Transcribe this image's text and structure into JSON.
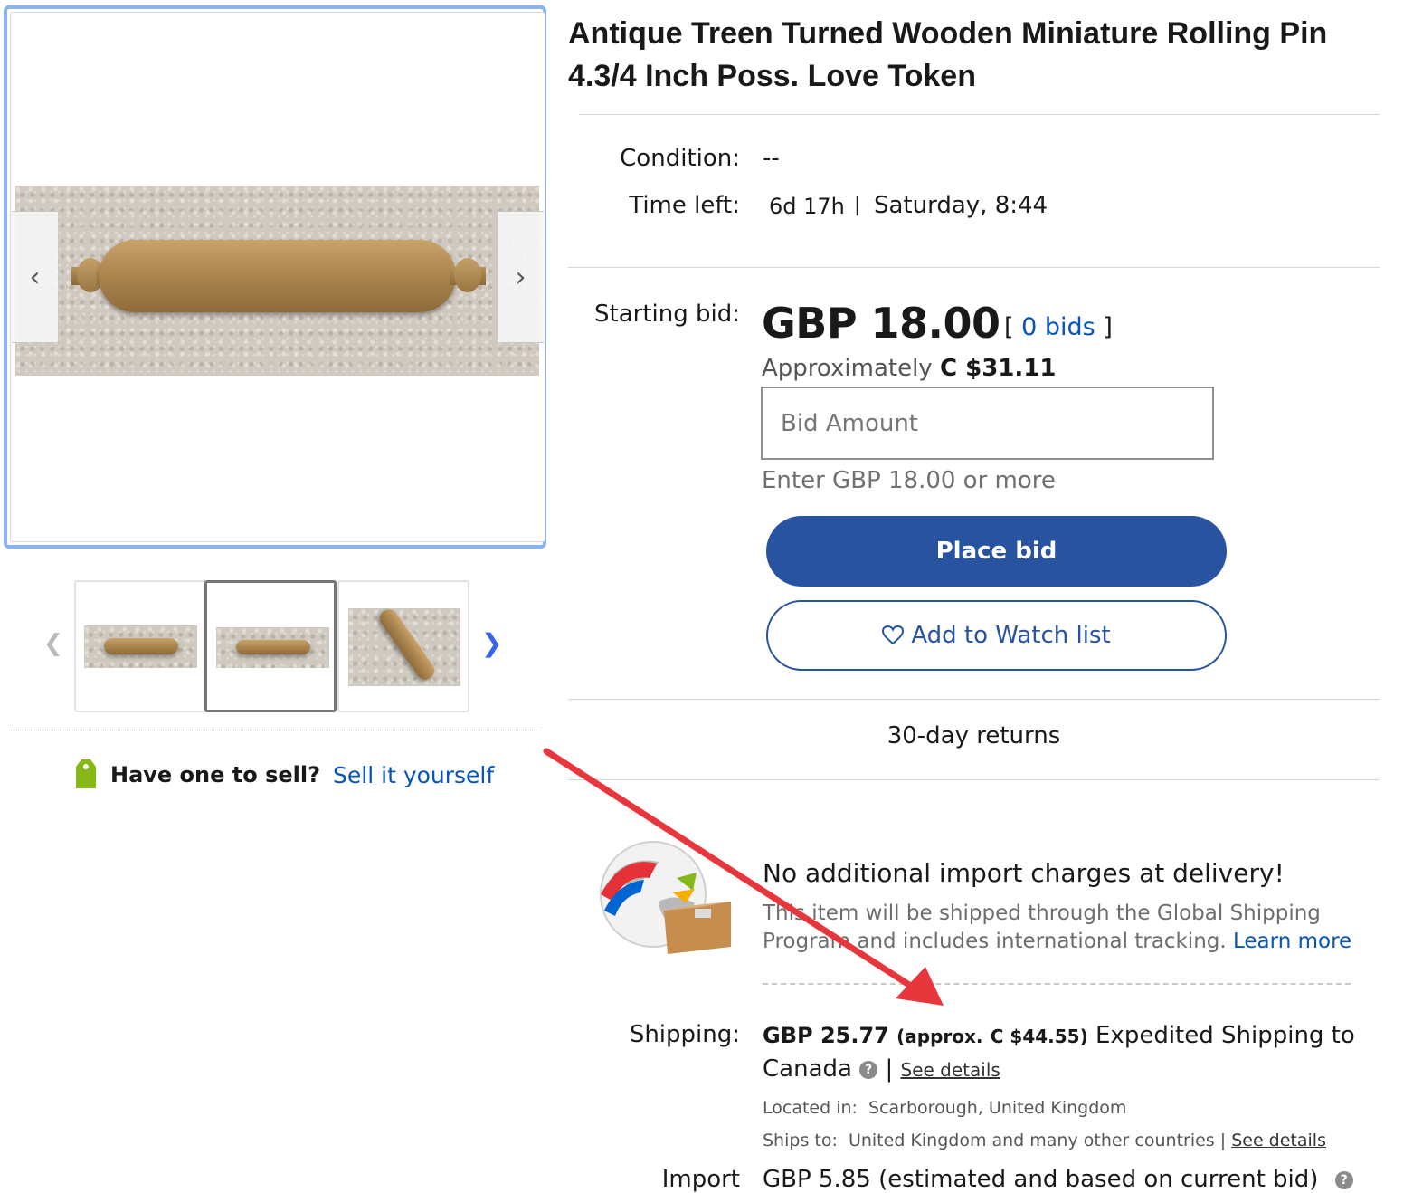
{
  "gallery": {
    "thumbnails": [
      {
        "alt": "Rolling pin full view",
        "selected": false
      },
      {
        "alt": "Rolling pin full view",
        "selected": true
      },
      {
        "alt": "Rolling pin handle close-up",
        "selected": false
      }
    ]
  },
  "sell": {
    "question": "Have one to sell?",
    "link": "Sell it yourself"
  },
  "item": {
    "title": "Antique Treen Turned Wooden Miniature Rolling Pin 4.3/4 Inch Poss. Love Token"
  },
  "details": {
    "condition_label": "Condition:",
    "condition_value": "--",
    "time_label": "Time left:",
    "time_remaining": "6d 17h",
    "time_separator": "|",
    "end_time": "Saturday, 8:44"
  },
  "bid": {
    "starting_label": "Starting bid:",
    "price": "GBP 18.00",
    "bid_open": "[",
    "bid_count": "0 bids",
    "bid_close": "]",
    "approx_prefix": "Approximately",
    "approx_value": "C $31.11",
    "input_placeholder": "Bid Amount",
    "hint": "Enter GBP 18.00 or more",
    "place_bid": "Place bid",
    "watch": "Add to Watch list"
  },
  "returns": "30-day returns",
  "gsp": {
    "heading": "No additional import charges at delivery!",
    "description": "This item will be shipped through the Global Shipping Program and includes international tracking.",
    "learn_more": "Learn more"
  },
  "shipping": {
    "label": "Shipping:",
    "amount": "GBP 25.77",
    "approx_open": "(approx.",
    "approx_value": "C $44.55)",
    "method": "Expedited Shipping to",
    "country": "Canada",
    "separator": "|",
    "see_details": "See details",
    "located_label": "Located in:",
    "located_value": "Scarborough, United Kingdom",
    "ships_to_label": "Ships to:",
    "ships_to_value": "United Kingdom and many other countries |",
    "ships_see_details": "See details"
  },
  "import": {
    "label": "Import",
    "text": "GBP 5.85 (estimated and based on current bid)"
  },
  "colors": {
    "accent_blue": "#2753a0",
    "link_blue": "#0654ba",
    "gallery_border": "#8ab4ee",
    "annotation_red": "#e8363d"
  }
}
